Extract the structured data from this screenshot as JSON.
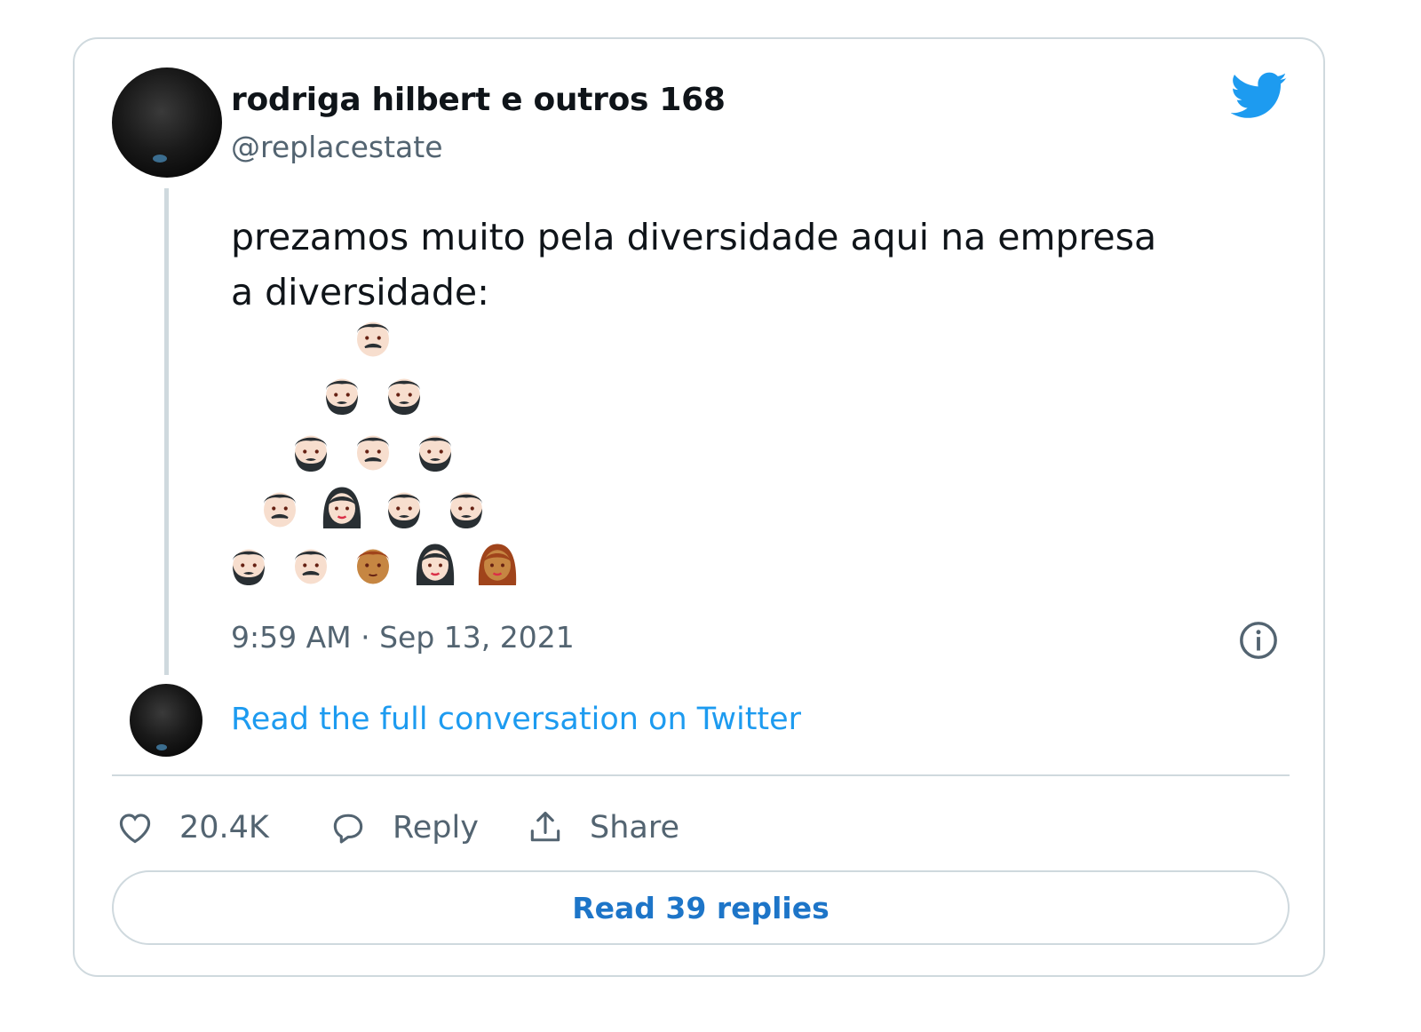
{
  "author": {
    "name": "rodriga hilbert e outros 168",
    "handle": "@replacestate"
  },
  "tweet": {
    "line1": "prezamos muito pela diversidade aqui na empresa",
    "line2": "a diversidade:",
    "timestamp": "9:59 AM · Sep 13, 2021"
  },
  "links": {
    "read_full": "Read the full conversation on Twitter"
  },
  "actions": {
    "like_count": "20.4K",
    "reply_label": "Reply",
    "share_label": "Share"
  },
  "read_replies_label": "Read 39 replies",
  "icons": {
    "brand": "twitter-bird-icon",
    "info": "info-icon",
    "like": "heart-icon",
    "reply": "speech-bubble-icon",
    "share": "share-upload-icon"
  },
  "colors": {
    "accent": "#1d9bf0",
    "muted": "#536471",
    "border": "#cfd9de"
  },
  "emoji_pyramid": [
    [
      "man-mustache"
    ],
    [
      "man-beard",
      "man-beard"
    ],
    [
      "man-beard",
      "man-mustache",
      "man-beard"
    ],
    [
      "man-mustache",
      "woman",
      "man-beard",
      "man-beard"
    ],
    [
      "man-beard",
      "man-mustache",
      "man-brown",
      "woman",
      "woman-brown"
    ]
  ]
}
